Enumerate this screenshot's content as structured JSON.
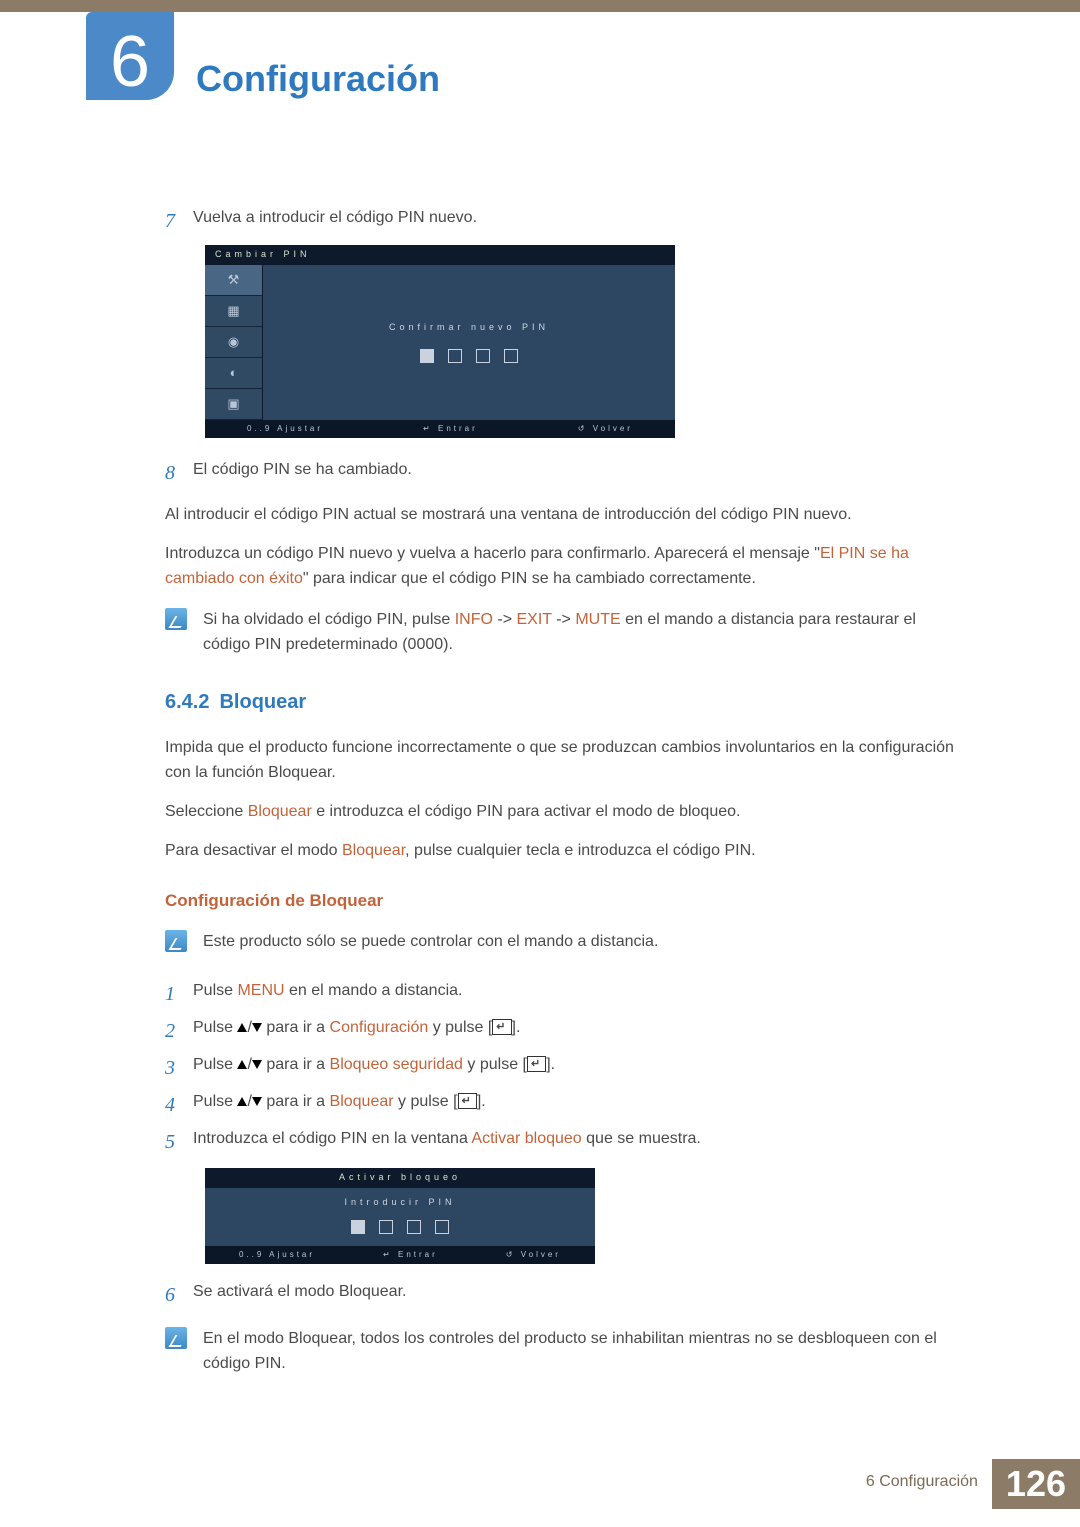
{
  "header": {
    "chapter_number": "6",
    "title": "Configuración"
  },
  "steps_a": {
    "s7": {
      "num": "7",
      "text": "Vuelva a introducir el código PIN nuevo."
    },
    "s8": {
      "num": "8",
      "text": "El código PIN se ha cambiado."
    }
  },
  "osd1": {
    "title": "Cambiar PIN",
    "label": "Confirmar nuevo PIN",
    "foot_adjust": "0..9 Ajustar",
    "foot_enter": "Entrar",
    "foot_return": "Volver",
    "side": {
      "i1": "⚒",
      "i2": "▦",
      "i3": "◉",
      "i4": "◐",
      "i5": "▣"
    }
  },
  "para1": "Al introducir el código PIN actual se mostrará una ventana de introducción del código PIN nuevo.",
  "para2a": "Introduzca un código PIN nuevo y vuelva a hacerlo para confirmarlo. Aparecerá el mensaje \"",
  "para2b": "El PIN se ha cambiado con éxito",
  "para2c": "\" para indicar que el código PIN se ha cambiado correctamente.",
  "note1a": "Si ha olvidado el código PIN, pulse ",
  "note1b": "INFO",
  "note1c": " -> ",
  "note1d": "EXIT",
  "note1e": " -> ",
  "note1f": "MUTE",
  "note1g": " en el mando a distancia para restaurar el código PIN predeterminado (0000).",
  "section2": {
    "num": "6.4.2",
    "title": "Bloquear"
  },
  "para3": "Impida que el producto funcione incorrectamente o que se produzcan cambios involuntarios en la configuración con la función Bloquear.",
  "para4a": "Seleccione ",
  "para4b": "Bloquear",
  "para4c": " e introduzca el código PIN para activar el modo de bloqueo.",
  "para5a": "Para desactivar el modo ",
  "para5b": "Bloquear",
  "para5c": ", pulse cualquier tecla e introduzca el código PIN.",
  "h3": "Configuración de Bloquear",
  "note2": "Este producto sólo se puede controlar con el mando a distancia.",
  "steps_b": {
    "s1": {
      "num": "1",
      "a": "Pulse ",
      "b": "MENU",
      "c": " en el mando a distancia."
    },
    "s2": {
      "num": "2",
      "a": "Pulse ",
      "mid": " para ir a ",
      "b": "Configuración",
      "c": " y pulse [",
      "d": "]."
    },
    "s3": {
      "num": "3",
      "a": "Pulse ",
      "mid": " para ir a ",
      "b": "Bloqueo seguridad",
      "c": " y pulse [",
      "d": "]."
    },
    "s4": {
      "num": "4",
      "a": "Pulse ",
      "mid": " para ir a ",
      "b": "Bloquear",
      "c": " y pulse [",
      "d": "]."
    },
    "s5": {
      "num": "5",
      "a": "Introduzca el código PIN en la ventana ",
      "b": "Activar bloqueo",
      "c": " que se muestra."
    },
    "s6": {
      "num": "6",
      "a": "Se activará el modo Bloquear."
    }
  },
  "osd2": {
    "title": "Activar bloqueo",
    "label": "Introducir PIN",
    "foot_adjust": "0..9 Ajustar",
    "foot_enter": "Entrar",
    "foot_return": "Volver"
  },
  "note3": "En el modo Bloquear, todos los controles del producto se inhabilitan mientras no se desbloqueen con el código PIN.",
  "footer": {
    "text": "6 Configuración",
    "page": "126"
  }
}
